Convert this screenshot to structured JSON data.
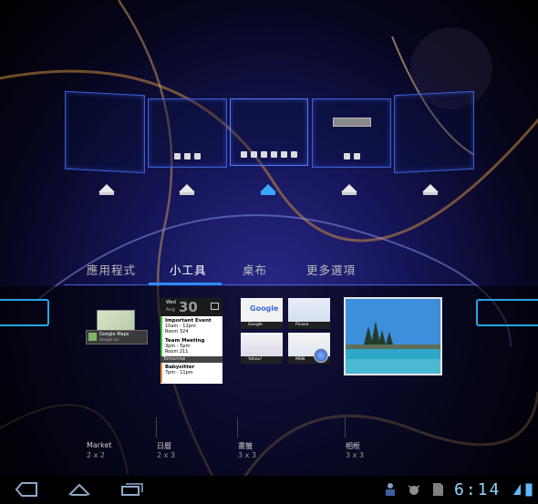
{
  "tabs": [
    {
      "label": "應用程式"
    },
    {
      "label": "小工具",
      "active": true
    },
    {
      "label": "桌布"
    },
    {
      "label": "更多選項"
    }
  ],
  "widgets": [
    {
      "name": "Market",
      "size": "2 x 2",
      "preview_title": "Google Maps",
      "preview_sub": "Google Inc."
    },
    {
      "name": "日曆",
      "size": "2 x 3"
    },
    {
      "name": "書籤",
      "size": "3 x 3"
    },
    {
      "name": "相框",
      "size": "3 x 3"
    }
  ],
  "calendar": {
    "weekday": "Wed",
    "month": "Aug",
    "day": "30",
    "events": [
      {
        "title": "Important Event",
        "time": "10am - 12pm",
        "room": "Room 324"
      },
      {
        "title": "Team Meeting",
        "time": "3pm - 5pm",
        "room": "Room 211"
      }
    ],
    "tomorrow_label": "Tomorrow",
    "tomorrow_event": {
      "title": "Babysitter",
      "time": "7pm - 11pm"
    }
  },
  "bookmarks": [
    "Google",
    "Picasa",
    "Yahoo!",
    "MSN"
  ],
  "bookmark_logo": "Google",
  "status": {
    "time": "6:14"
  },
  "colors": {
    "accent": "#2f8cff",
    "panel_border": "#3a5fd8",
    "clock": "#8fd4ff"
  },
  "icons": [
    "back-icon",
    "home-icon",
    "recent-apps-icon",
    "usb-icon",
    "debug-icon",
    "sd-card-icon",
    "wifi-icon",
    "battery-icon"
  ]
}
